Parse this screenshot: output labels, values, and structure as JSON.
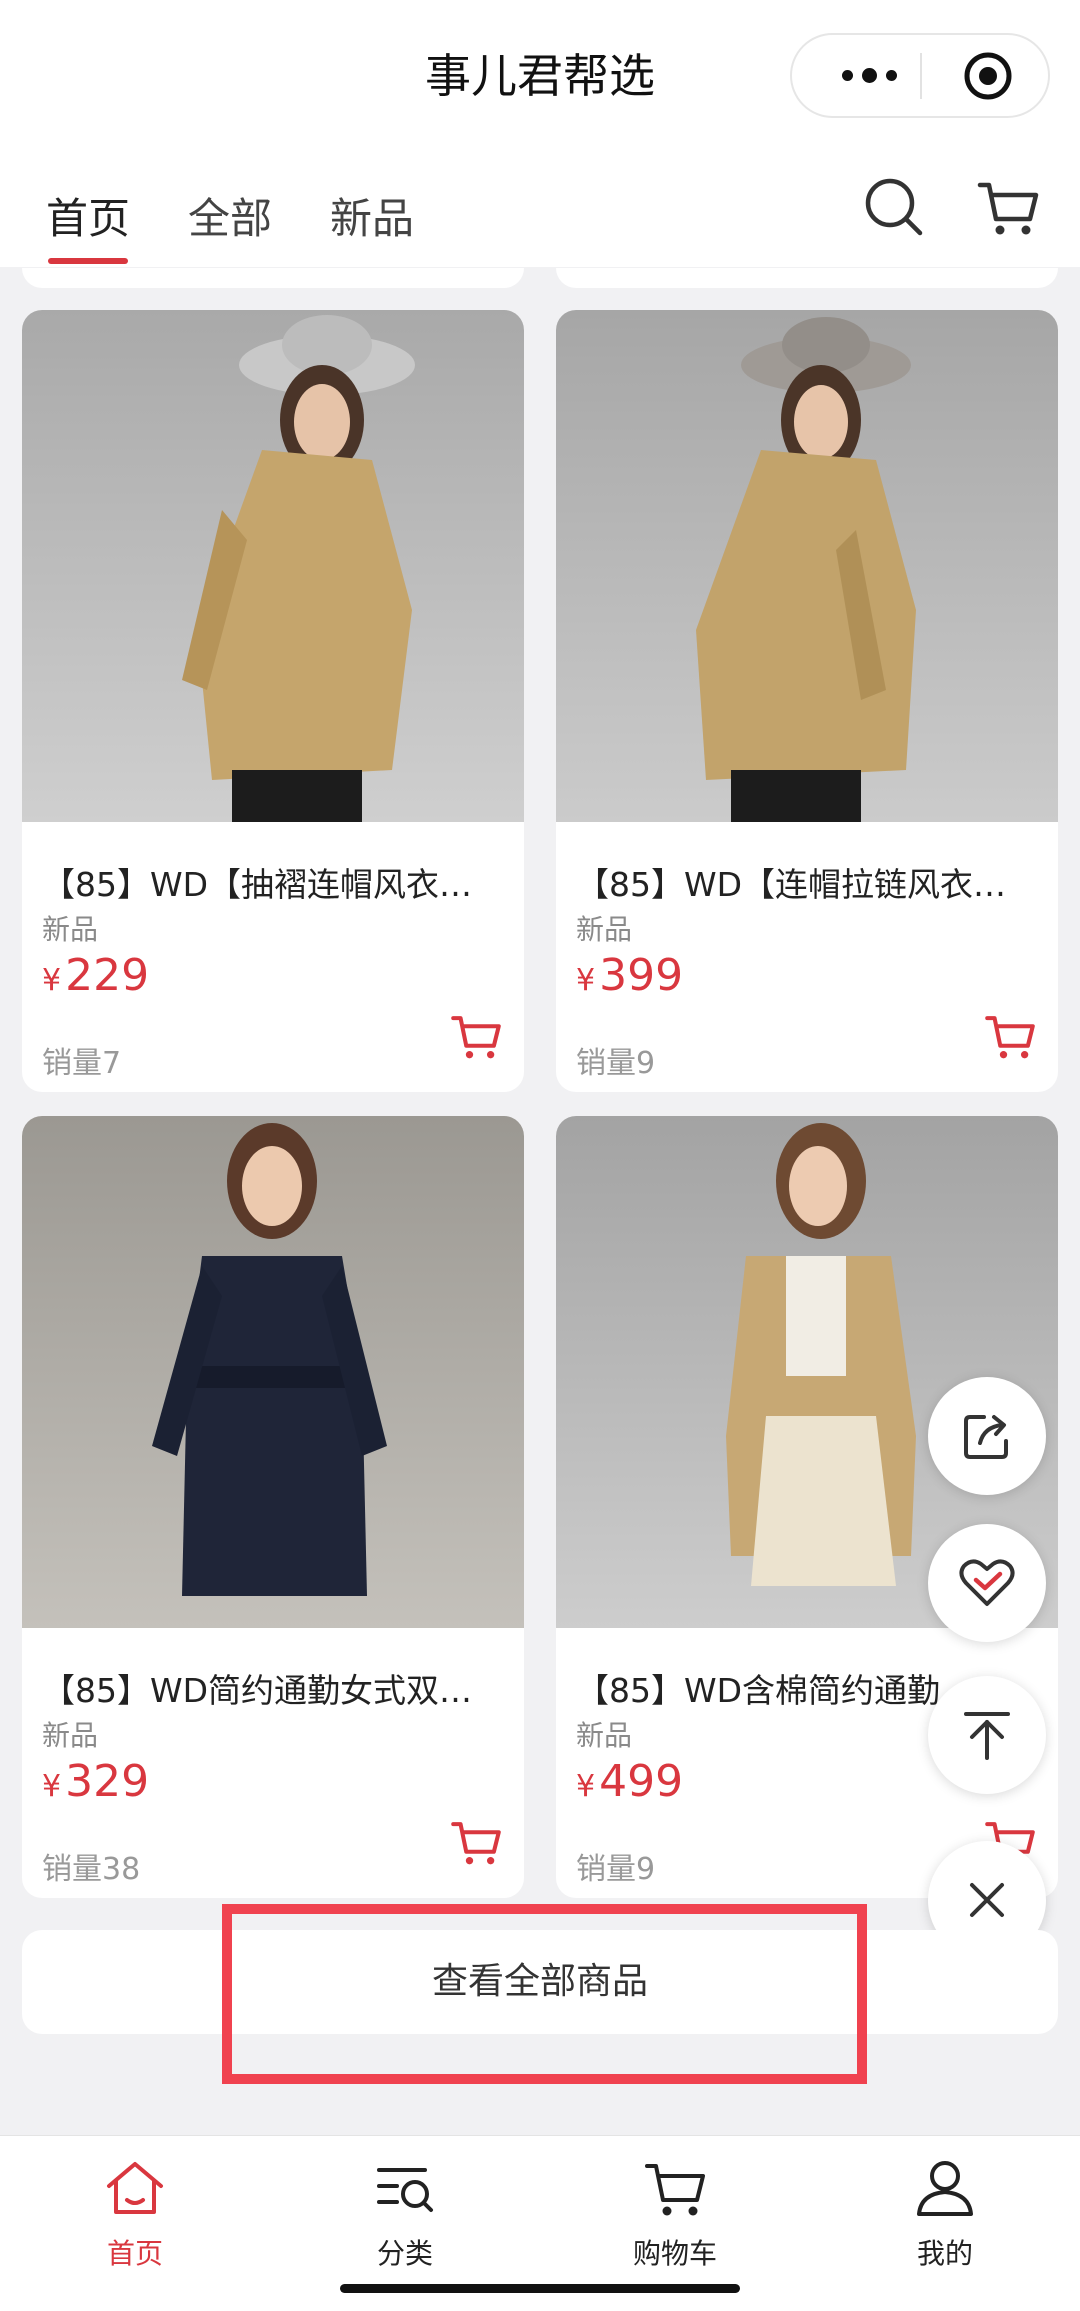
{
  "app": {
    "title": "事儿君帮选"
  },
  "tabs": [
    {
      "label": "首页",
      "active": true
    },
    {
      "label": "全部",
      "active": false
    },
    {
      "label": "新品",
      "active": false
    }
  ],
  "products": [
    {
      "name": "【85】WD【抽褶连帽风衣…",
      "tag": "新品",
      "currency": "¥",
      "price": "229",
      "sales": "销量7"
    },
    {
      "name": "【85】WD【连帽拉链风衣…",
      "tag": "新品",
      "currency": "¥",
      "price": "399",
      "sales": "销量9"
    },
    {
      "name": "【85】WD简约通勤女式双…",
      "tag": "新品",
      "currency": "¥",
      "price": "329",
      "sales": "销量38"
    },
    {
      "name": "【85】WD含棉简约通勤…",
      "tag": "新品",
      "currency": "¥",
      "price": "499",
      "sales": "销量9"
    }
  ],
  "view_all": {
    "label": "查看全部商品"
  },
  "bottom_nav": [
    {
      "label": "首页",
      "icon": "home-icon",
      "active": true
    },
    {
      "label": "分类",
      "icon": "category-icon",
      "active": false
    },
    {
      "label": "购物车",
      "icon": "cart-icon",
      "active": false
    },
    {
      "label": "我的",
      "icon": "user-icon",
      "active": false
    }
  ],
  "colors": {
    "accent": "#d9373f",
    "highlight_box": "#f0424f",
    "background": "#f1f1f3"
  }
}
